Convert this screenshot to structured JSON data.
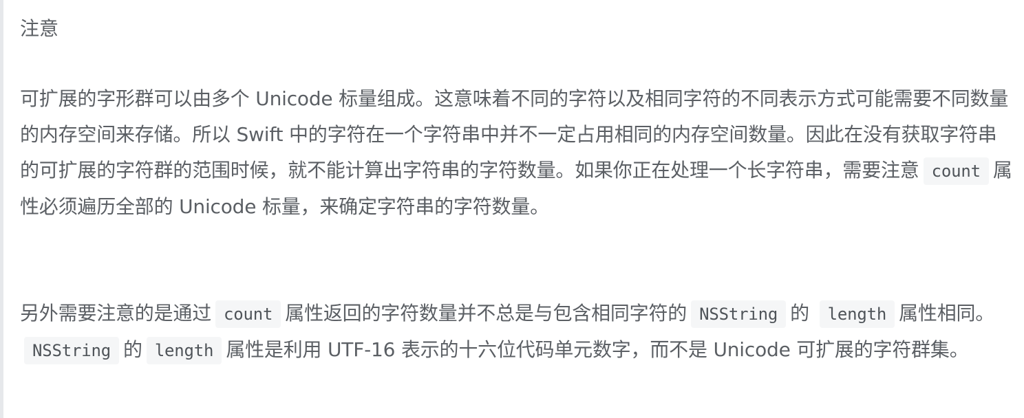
{
  "note": {
    "title": "注意",
    "paragraph1": {
      "text_a": "可扩展的字形群可以由多个 Unicode 标量组成。这意味着不同的字符以及相同字符的不同表示方式可能需要不同数量的内存空间来存储。所以 Swift 中的字符在一个字符串中并不一定占用相同的内存空间数量。因此在没有获取字符串的可扩展的字符群的范围时候，就不能计算出字符串的字符数量。如果你正在处理一个长字符串，需要注意",
      "code_count": "count",
      "text_b": "属性必须遍历全部的 Unicode 标量，来确定字符串的字符数量。"
    },
    "paragraph2": {
      "text_a": "另外需要注意的是通过",
      "code_count": "count",
      "text_b": "属性返回的字符数量并不总是与包含相同字符的",
      "code_nsstring": "NSString",
      "text_c": "的",
      "code_length_1": "length",
      "text_d": "属性相同。",
      "code_nsstring_2": "NSString",
      "text_e": "的",
      "code_length_2": "length",
      "text_f": "属性是利用 UTF-16 表示的十六位代码单元数字，而不是 Unicode 可扩展的字符群集。"
    }
  }
}
